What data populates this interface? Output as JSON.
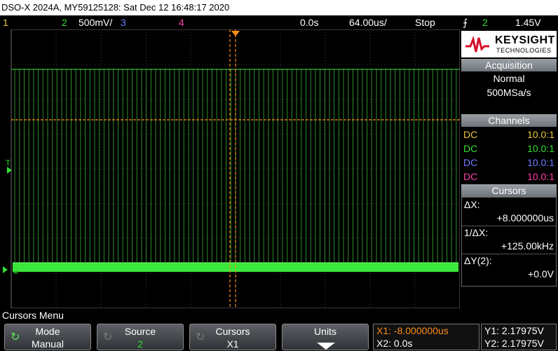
{
  "title": "DSO-X 2024A, MY59125128: Sat Dec 12 16:48:17 2020",
  "status": {
    "ch1": "1",
    "ch2": "2",
    "ch2_scale": "500mV/",
    "ch3": "3",
    "ch4": "4",
    "time_offset": "0.0s",
    "time_scale": "64.00us/",
    "run_state": "Stop",
    "trigger_source": "2",
    "trigger_level": "1.45V"
  },
  "brand": {
    "name": "KEYSIGHT",
    "sub": "TECHNOLOGIES"
  },
  "acquisition": {
    "header": "Acquisition",
    "mode": "Normal",
    "rate": "500MSa/s"
  },
  "channels": {
    "header": "Channels",
    "rows": [
      {
        "coupling": "DC",
        "probe": "10.0:1",
        "color": "#e8c33a"
      },
      {
        "coupling": "DC",
        "probe": "10.0:1",
        "color": "#33dd33"
      },
      {
        "coupling": "DC",
        "probe": "10.0:1",
        "color": "#6f7bff"
      },
      {
        "coupling": "DC",
        "probe": "10.0:1",
        "color": "#ff3da8"
      }
    ]
  },
  "cursors": {
    "header": "Cursors",
    "dx_label": "ΔX:",
    "dx_value": "+8.000000us",
    "inv_dx_label": "1/ΔX:",
    "inv_dx_value": "+125.00kHz",
    "dy_label": "ΔY(2):",
    "dy_value": "+0.0V",
    "x1": "X1: -8.000000us",
    "x2": "X2: 0.0s",
    "y1": "Y1: 2.17975V",
    "y2": "Y2: 2.17975V"
  },
  "markers": {
    "trigger": "T",
    "ch2_ground": "2"
  },
  "menu": {
    "title": "Cursors Menu",
    "keys": [
      {
        "label": "Mode",
        "value": "Manual"
      },
      {
        "label": "Source",
        "value": "2"
      },
      {
        "label": "Cursors",
        "value": "X1"
      },
      {
        "label": "Units",
        "value": ""
      }
    ]
  },
  "colors": {
    "ch1": "#e8c33a",
    "ch2": "#33dd33",
    "ch3": "#6f7bff",
    "ch4": "#ff3da8",
    "cursor": "#ff8c1a"
  }
}
